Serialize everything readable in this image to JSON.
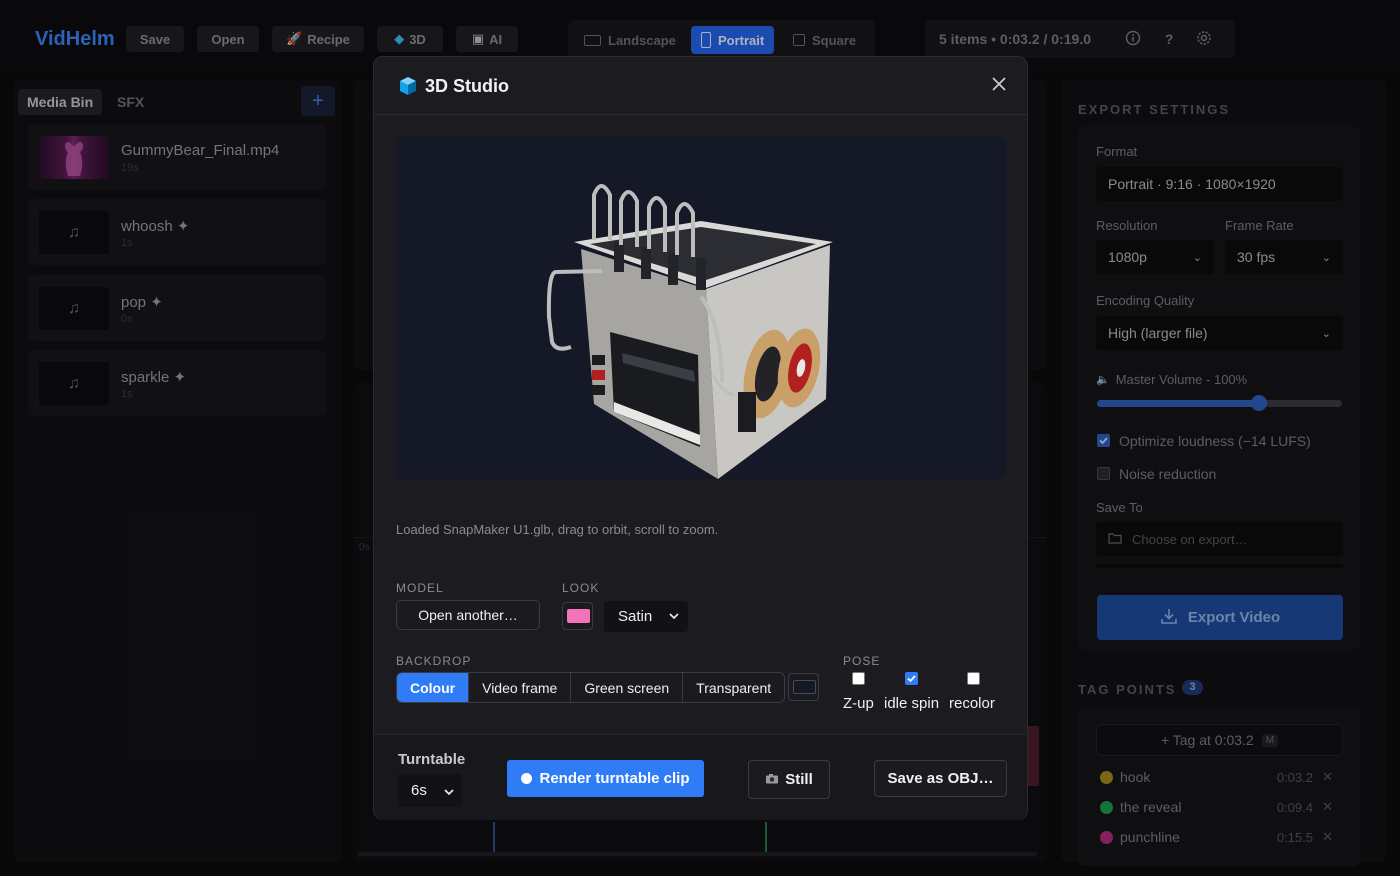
{
  "app": {
    "brand": "VidHelm",
    "toolbar": {
      "save": "Save",
      "open": "Open",
      "recipe": "Recipe",
      "three_d": "3D",
      "ai": "AI"
    },
    "aspect": {
      "landscape": "Landscape",
      "portrait": "Portrait",
      "square": "Square",
      "selected": "Portrait"
    },
    "status": "5 items • 0:03.2 / 0:19.0"
  },
  "left_panel": {
    "tabs": [
      "Media Bin",
      "SFX"
    ],
    "add_label": "+",
    "items": [
      {
        "name": "GummyBear_Final.mp4",
        "duration": "19s",
        "kind": "video"
      },
      {
        "name": "whoosh ✦",
        "duration": "1s",
        "kind": "audio"
      },
      {
        "name": "pop ✦",
        "duration": "0s",
        "kind": "audio"
      },
      {
        "name": "sparkle ✦",
        "duration": "1s",
        "kind": "audio"
      }
    ]
  },
  "timeline": {
    "zero_label": "0s"
  },
  "export": {
    "title": "EXPORT SETTINGS",
    "format_label": "Format",
    "format_value": "Portrait · 9:16 · 1080×1920",
    "resolution_label": "Resolution",
    "resolution_value": "1080p",
    "frame_rate_label": "Frame Rate",
    "frame_rate_value": "30 fps",
    "quality_label": "Encoding Quality",
    "quality_value": "High (larger file)",
    "volume_label": "Master Volume - 100%",
    "volume_level": 0.66,
    "optimize_label": "Optimize loudness (−14 LUFS)",
    "optimize_checked": true,
    "noise_label": "Noise reduction",
    "noise_checked": false,
    "save_to_label": "Save To",
    "save_to_placeholder": "Choose on export…",
    "export_button": "Export Video"
  },
  "tags": {
    "title": "TAG POINTS",
    "count": "3",
    "add_label": "+ Tag at 0:03.2",
    "add_key": "M",
    "items": [
      {
        "name": "hook",
        "time": "0:03.2",
        "color": "#a68a1f"
      },
      {
        "name": "the reveal",
        "time": "0:09.4",
        "color": "#1f9a4a"
      },
      {
        "name": "punchline",
        "time": "0:15.5",
        "color": "#b02d7c"
      }
    ]
  },
  "studio": {
    "title": "3D Studio",
    "hint": "Loaded SnapMaker U1.glb, drag to orbit, scroll to zoom.",
    "model_label": "MODEL",
    "open_another": "Open another…",
    "look_label": "LOOK",
    "look_color": "#f472b6",
    "look_value": "Satin",
    "backdrop_label": "BACKDROP",
    "backdrop_options": [
      "Colour",
      "Video frame",
      "Green screen",
      "Transparent"
    ],
    "backdrop_selected": "Colour",
    "backdrop_color": "#141827",
    "pose_label": "POSE",
    "pose": [
      {
        "label": "Z-up",
        "checked": false
      },
      {
        "label": "idle spin",
        "checked": true
      },
      {
        "label": "recolor",
        "checked": false
      }
    ],
    "turntable_label": "Turntable",
    "turntable_value": "6s",
    "render_button": "Render turntable clip",
    "still_button": "Still",
    "obj_button": "Save as OBJ…"
  },
  "colors": {
    "accent": "#2f7cf6",
    "brand": "#3b82f6",
    "modal_bg": "#1b1b20",
    "viewport_bg": "#141827"
  }
}
